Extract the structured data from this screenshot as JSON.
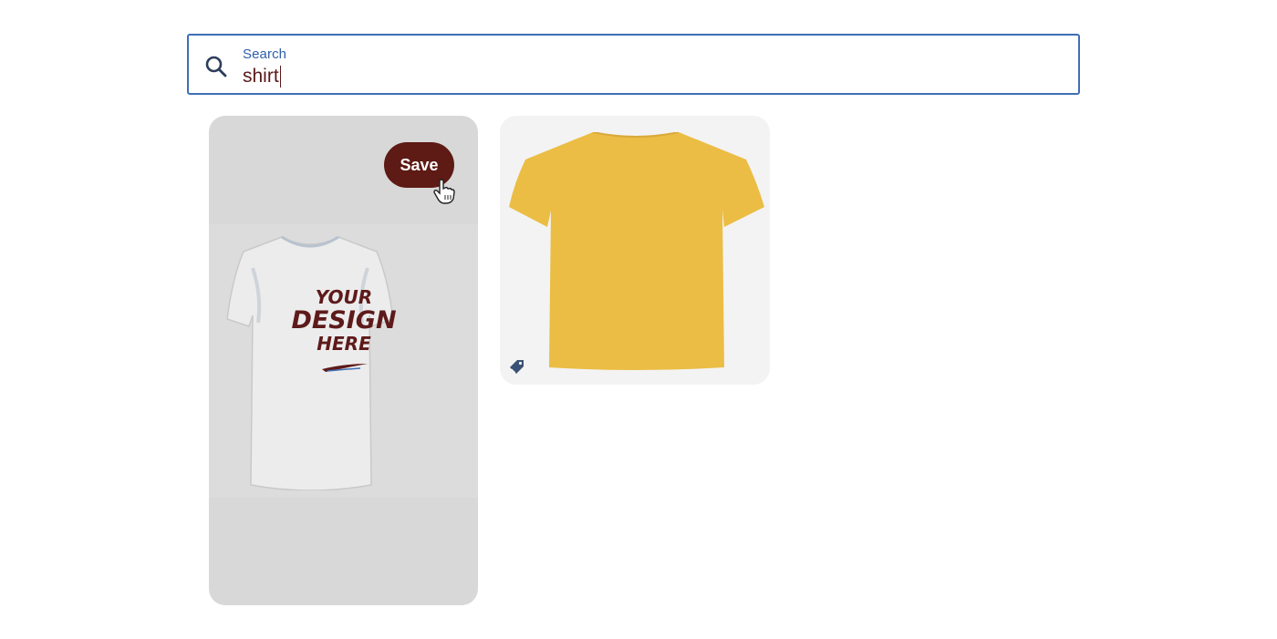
{
  "search": {
    "label": "Search",
    "value": "shirt"
  },
  "pins": [
    {
      "save_label": "Save",
      "design_text": [
        "YOUR",
        "DESIGN",
        "HERE"
      ],
      "shirt_color": "#ececec"
    },
    {
      "shirt_color": "#ebbd44",
      "badge_icon": "tag-icon"
    }
  ],
  "colors": {
    "accent": "#5e1a14",
    "search_border": "#3f6fb5"
  }
}
